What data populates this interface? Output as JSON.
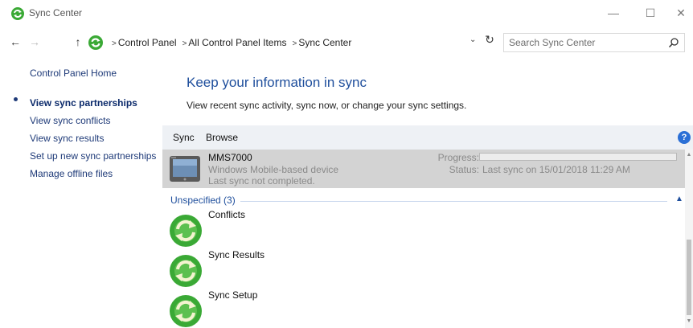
{
  "window": {
    "title": "Sync Center",
    "minimize_icon": "minimize-icon",
    "maximize_icon": "maximize-icon",
    "close_icon": "close-icon",
    "min_glyph": "—",
    "max_glyph": "☐",
    "close_glyph": "✕"
  },
  "address_bar": {
    "breadcrumbs": [
      "Control Panel",
      "All Control Panel Items",
      "Sync Center"
    ],
    "search_placeholder": "Search Sync Center"
  },
  "left_pane": {
    "home": "Control Panel Home",
    "links": [
      {
        "label": "View sync partnerships",
        "active": true
      },
      {
        "label": "View sync conflicts",
        "active": false
      },
      {
        "label": "View sync results",
        "active": false
      },
      {
        "label": "Set up new sync partnerships",
        "active": false
      },
      {
        "label": "Manage offline files",
        "active": false
      }
    ]
  },
  "main": {
    "heading": "Keep your information in sync",
    "subtext": "View recent sync activity, sync now, or change your sync settings."
  },
  "toolbar": {
    "sync": "Sync",
    "browse": "Browse",
    "help_glyph": "?"
  },
  "device": {
    "name": "MMS7000",
    "type": "Windows Mobile-based device",
    "status": "Last sync not completed.",
    "progress_label": "Progress:",
    "progress_value": 0,
    "status_label": "Status:",
    "status_value": "Last sync on 15/01/2018 11:29 AM"
  },
  "group": {
    "label": "Unspecified (3)",
    "items": [
      {
        "label": "Conflicts"
      },
      {
        "label": "Sync Results"
      },
      {
        "label": "Sync Setup"
      }
    ]
  },
  "colors": {
    "link": "#1e3a78",
    "heading": "#1e4e9c",
    "selected_row": "#d3d3d3",
    "sync_icon_green": "#3aa935"
  }
}
